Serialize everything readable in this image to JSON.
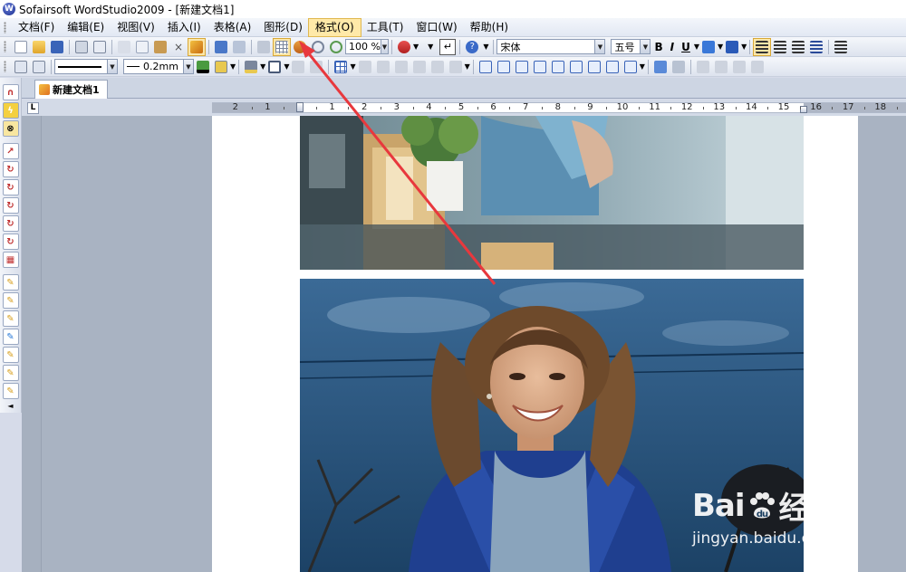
{
  "app": {
    "title": "Sofairsoft WordStudio2009 - [新建文档1]"
  },
  "menu": {
    "items": [
      {
        "label": "文档(F)"
      },
      {
        "label": "编辑(E)"
      },
      {
        "label": "视图(V)"
      },
      {
        "label": "插入(I)"
      },
      {
        "label": "表格(A)"
      },
      {
        "label": "图形(D)"
      },
      {
        "label": "格式(O)"
      },
      {
        "label": "工具(T)"
      },
      {
        "label": "窗口(W)"
      },
      {
        "label": "帮助(H)"
      }
    ]
  },
  "toolbar": {
    "zoom": "100 %",
    "font_name": "宋体",
    "font_size": "五号",
    "bold_label": "B",
    "italic_label": "I",
    "underline_label": "U",
    "line_width": "0.2mm"
  },
  "tabs": {
    "doc_tab": "新建文档1"
  },
  "ruler": {
    "corner": "L",
    "left_labels": [
      "2",
      "1"
    ],
    "labels": [
      "1",
      "2",
      "3",
      "4",
      "5",
      "6",
      "7",
      "8",
      "9",
      "10",
      "11",
      "12",
      "13",
      "14",
      "15",
      "16",
      "17",
      "18"
    ]
  },
  "watermark": {
    "brand_left": "Bai",
    "brand_right": "经验",
    "url": "jingyan.baidu.com"
  },
  "colors": {
    "menu_highlight": "#ffe9a8",
    "annotation_arrow": "#e8383d",
    "workspace": "#a9b3c2"
  }
}
